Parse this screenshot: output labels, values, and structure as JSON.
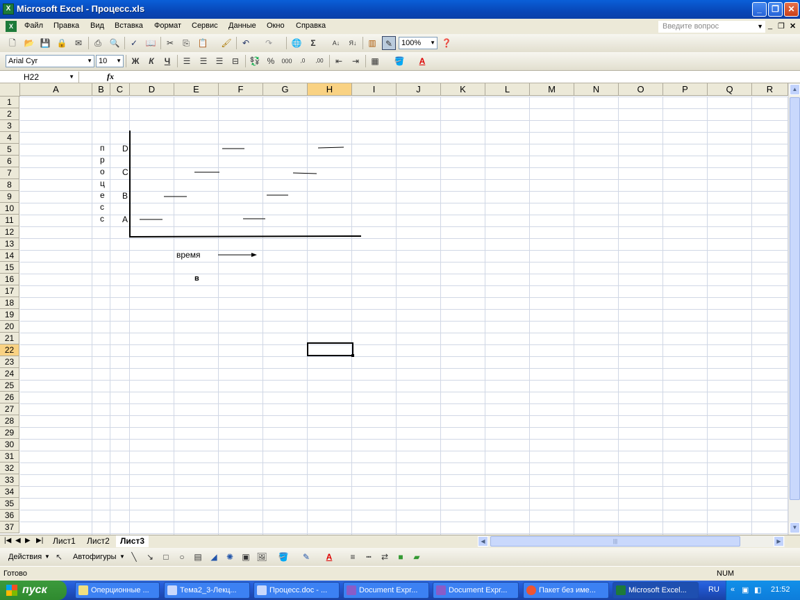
{
  "window": {
    "title": "Microsoft Excel - Процесс.xls",
    "minimize": "_",
    "restore": "❐",
    "close": "✕"
  },
  "menu": {
    "items": [
      "Файл",
      "Правка",
      "Вид",
      "Вставка",
      "Формат",
      "Сервис",
      "Данные",
      "Окно",
      "Справка"
    ],
    "ask_placeholder": "Введите вопрос"
  },
  "toolbar": {
    "zoom": "100%",
    "font": "Arial Cyr",
    "size": "10",
    "bold": "Ж",
    "italic": "К",
    "underline": "Ч",
    "percent": "%",
    "thousands": "000",
    "inc_dec": ",0",
    "dec_dec": ",00"
  },
  "formula": {
    "namebox": "H22",
    "fx": "fx",
    "content": ""
  },
  "columns": [
    "A",
    "B",
    "C",
    "D",
    "E",
    "F",
    "G",
    "H",
    "I",
    "J",
    "K",
    "L",
    "M",
    "N",
    "O",
    "P",
    "Q",
    "R"
  ],
  "active_column": "H",
  "rows": [
    "1",
    "2",
    "3",
    "4",
    "5",
    "6",
    "7",
    "8",
    "9",
    "10",
    "11",
    "12",
    "13",
    "14",
    "15",
    "16",
    "17",
    "18",
    "19",
    "20",
    "21",
    "22",
    "23",
    "24",
    "25",
    "26",
    "27",
    "28",
    "29",
    "30",
    "31",
    "32",
    "33",
    "34",
    "35",
    "36",
    "37"
  ],
  "active_row": "22",
  "cells": {
    "vertical_letters": [
      "п",
      "р",
      "о",
      "ц",
      "е",
      "с",
      "с"
    ],
    "label_d": "D",
    "label_c": "C",
    "label_b": "B",
    "label_a": "A",
    "time_label": "время",
    "b16": "в"
  },
  "sheets": {
    "tabs": [
      "Лист1",
      "Лист2",
      "Лист3"
    ],
    "active": "Лист3"
  },
  "drawing": {
    "actions": "Действия",
    "autoshapes": "Автофигуры"
  },
  "status": {
    "ready": "Готово",
    "num": "NUM"
  },
  "taskbar": {
    "start": "пуск",
    "tasks": [
      "Оперционные ...",
      "Тема2_3-Лекц...",
      "Процесс.doc - ...",
      "Document Expr...",
      "Document Expr...",
      "Пакет без име...",
      "Microsoft Excel..."
    ],
    "lang": "RU",
    "time": "21:52"
  }
}
